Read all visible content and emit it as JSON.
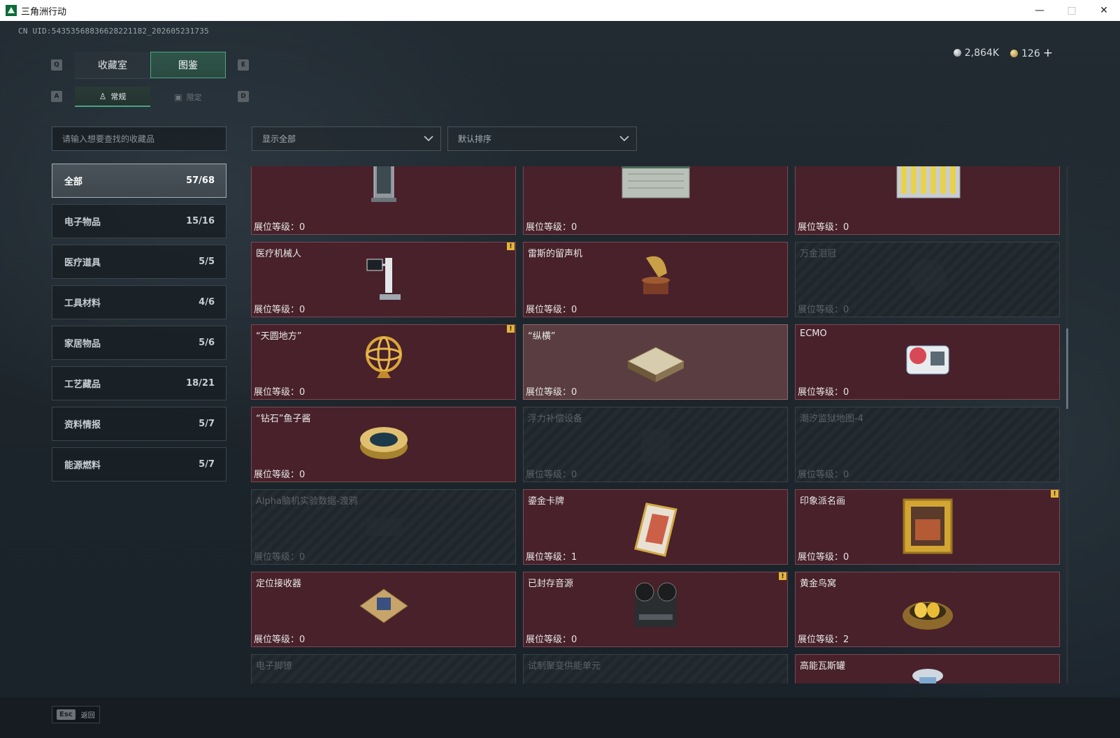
{
  "window": {
    "title": "三角洲行动",
    "minimize": "—",
    "maximize": "□",
    "close": "✕"
  },
  "uid_text": "CN UID:5435356883662822118​2_202605231735",
  "currency": {
    "silver": "2,864K",
    "gold": "126",
    "plus": "+"
  },
  "keys": {
    "q": "Q",
    "e": "E",
    "a": "A",
    "d": "D",
    "esc": "Esc"
  },
  "tabs": [
    {
      "label": "收藏室"
    },
    {
      "label": "图鉴"
    }
  ],
  "subtabs": [
    {
      "label": "常规"
    },
    {
      "label": "限定"
    }
  ],
  "search": {
    "placeholder": "请输入想要查找的收藏品"
  },
  "filters": {
    "show": "显示全部",
    "sort": "默认排序"
  },
  "categories": [
    {
      "name": "全部",
      "count": "57/68"
    },
    {
      "name": "电子物品",
      "count": "15/16"
    },
    {
      "name": "医疗道具",
      "count": "5/5"
    },
    {
      "name": "工具材料",
      "count": "4/6"
    },
    {
      "name": "家居物品",
      "count": "5/6"
    },
    {
      "name": "工艺藏品",
      "count": "18/21"
    },
    {
      "name": "资料情报",
      "count": "5/7"
    },
    {
      "name": "能源燃料",
      "count": "5/7"
    }
  ],
  "level_prefix": "展位等级：",
  "items": [
    {
      "name": "",
      "level": "0",
      "state": "owned",
      "warn": false,
      "icon": "reactor-icon"
    },
    {
      "name": "",
      "level": "0",
      "state": "owned",
      "warn": false,
      "icon": "server-box-icon"
    },
    {
      "name": "",
      "level": "0",
      "state": "owned",
      "warn": false,
      "icon": "battery-pack-icon"
    },
    {
      "name": "医疗机械人",
      "level": "0",
      "state": "owned",
      "warn": true,
      "icon": "medical-robot-icon"
    },
    {
      "name": "雷斯的留声机",
      "level": "0",
      "state": "owned",
      "warn": false,
      "icon": "gramophone-icon"
    },
    {
      "name": "万金泪冠",
      "level": "0",
      "state": "locked",
      "warn": false,
      "icon": "crown-icon"
    },
    {
      "name": "“天圆地方”",
      "level": "0",
      "state": "owned",
      "warn": true,
      "icon": "armillary-sphere-icon"
    },
    {
      "name": "“纵横”",
      "level": "0",
      "state": "selected",
      "warn": false,
      "icon": "chessboard-icon"
    },
    {
      "name": "ECMO",
      "level": "0",
      "state": "owned",
      "warn": false,
      "icon": "ecmo-machine-icon"
    },
    {
      "name": "“钻石”鱼子酱",
      "level": "0",
      "state": "owned",
      "warn": false,
      "icon": "caviar-tin-icon"
    },
    {
      "name": "浮力补偿设备",
      "level": "0",
      "state": "locked",
      "warn": false,
      "icon": "buoyancy-device-icon"
    },
    {
      "name": "潮汐监狱地图-4",
      "level": "0",
      "state": "locked",
      "warn": false,
      "icon": "map-icon"
    },
    {
      "name": "Alpha脑机实验数据-渡鸦",
      "level": "0",
      "state": "locked",
      "warn": false,
      "icon": "data-drive-icon"
    },
    {
      "name": "鎏金卡牌",
      "level": "1",
      "state": "owned",
      "warn": false,
      "icon": "gilded-card-icon"
    },
    {
      "name": "印象派名画",
      "level": "0",
      "state": "owned",
      "warn": true,
      "icon": "painting-icon"
    },
    {
      "name": "定位接收器",
      "level": "0",
      "state": "owned",
      "warn": false,
      "icon": "receiver-icon"
    },
    {
      "name": "已封存音源",
      "level": "0",
      "state": "owned",
      "warn": true,
      "icon": "tape-recorder-icon"
    },
    {
      "name": "黄金鸟窝",
      "level": "2",
      "state": "owned",
      "warn": false,
      "icon": "golden-nest-icon"
    },
    {
      "name": "电子脚镣",
      "level": "",
      "state": "locked",
      "warn": false,
      "icon": "ankle-monitor-icon"
    },
    {
      "name": "试制聚变供能单元",
      "level": "",
      "state": "locked",
      "warn": false,
      "icon": "fusion-cell-icon"
    },
    {
      "name": "高能瓦斯罐",
      "level": "",
      "state": "owned",
      "warn": false,
      "icon": "gas-canister-icon"
    }
  ],
  "back_label": "返回",
  "colors": {
    "accent_green": "#4fa786",
    "card_owned": "#48212a",
    "card_locked": "#1f262c",
    "warn": "#e3b53b"
  }
}
